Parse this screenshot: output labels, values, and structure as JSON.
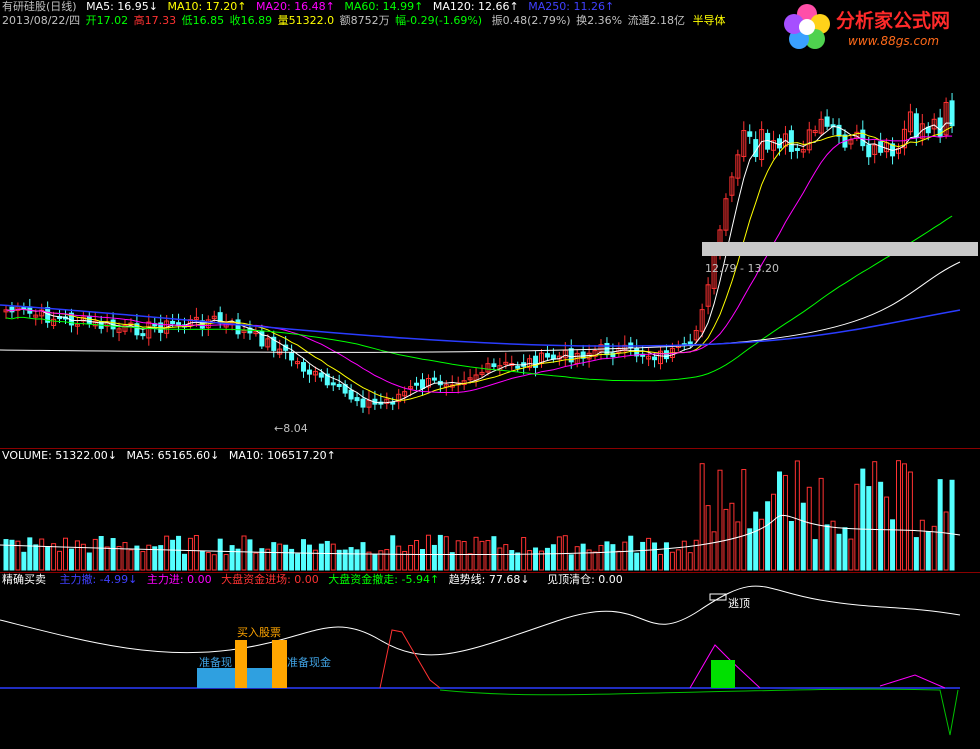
{
  "info_row": {
    "title": "有研硅股(日线)",
    "ma5": "MA5: 16.95↓",
    "ma10": "MA10: 17.20↑",
    "ma20": "MA20: 16.48↑",
    "ma60": "MA60: 14.99↑",
    "ma120": "MA120: 12.66↑",
    "ma250": "MA250: 11.26↑"
  },
  "ohlc_row": {
    "date": "2013/08/22/四",
    "open": "开17.02",
    "high": "高17.33",
    "low": "低16.85",
    "close": "收16.89",
    "volume": "量51322.0",
    "amount": "额8752万",
    "change": "幅-0.29(-1.69%)",
    "amplitude": "振0.48(2.79%)",
    "turnover": "换2.36%",
    "float_cap": "流通2.18亿",
    "sector": "半导体"
  },
  "price_panel": {
    "low_marker": "←8.04",
    "range_label": "12.79 - 13.20"
  },
  "volume_row": {
    "volume": "VOLUME: 51322.00↓",
    "ma5": "MA5: 65165.60↓",
    "ma10": "MA10: 106517.20↑"
  },
  "indicator_row": {
    "name": "精确买卖",
    "main_out": "主力撤: -4.99↓",
    "main_in": "主力进: 0.00",
    "market_in": "大盘资金进场: 0.00",
    "market_out": "大盘资金撤走: -5.94↑",
    "trend": "趋势线: 77.68↓",
    "top_clear": "见顶清仓: 0.00"
  },
  "indicator_marks": {
    "buy_stock": "买入股票",
    "prepare_cash_1": "准备现",
    "prepare_cash_2": "准备现金",
    "escape": "逃顶"
  },
  "logo": {
    "name": "分析家公式网",
    "url": "www.88gs.com"
  },
  "colors": {
    "up": "#ff3232",
    "down": "#54ffff",
    "ma5": "#ffffff",
    "ma10": "#ffff00",
    "ma20": "#ff00ff",
    "ma60": "#00ff00",
    "ma120": "#ffffff",
    "ma250": "#0000ff",
    "axis_red": "#8a0000"
  }
}
